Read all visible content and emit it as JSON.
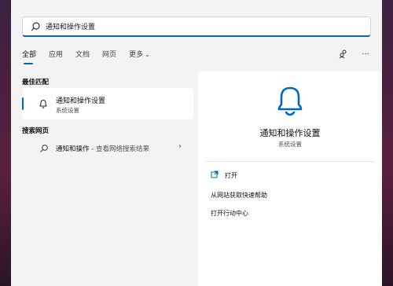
{
  "search": {
    "value": "通知和操作设置"
  },
  "tabs": [
    {
      "label": "全部"
    },
    {
      "label": "应用"
    },
    {
      "label": "文档"
    },
    {
      "label": "网页"
    },
    {
      "label": "更多"
    }
  ],
  "tabs_more_chevron": "⌄",
  "top_icons": [
    "share-accounts-icon",
    "more-options-icon"
  ],
  "more_options_glyph": "···",
  "best_match": {
    "section_title": "最佳匹配",
    "title": "通知和操作设置",
    "subtitle": "系统设置"
  },
  "web_search": {
    "section_title": "搜索网页",
    "query": "通知和操作",
    "suffix": " - 查看网络搜索结果",
    "arrow": "›"
  },
  "detail": {
    "title": "通知和操作设置",
    "subtitle": "系统设置",
    "actions": [
      {
        "label": "打开"
      },
      {
        "label": "从网站获取快速帮助"
      },
      {
        "label": "打开行动中心"
      }
    ]
  },
  "colors": {
    "accent": "#0067c0",
    "panel": "#f3f3f3",
    "card": "#ffffff"
  }
}
